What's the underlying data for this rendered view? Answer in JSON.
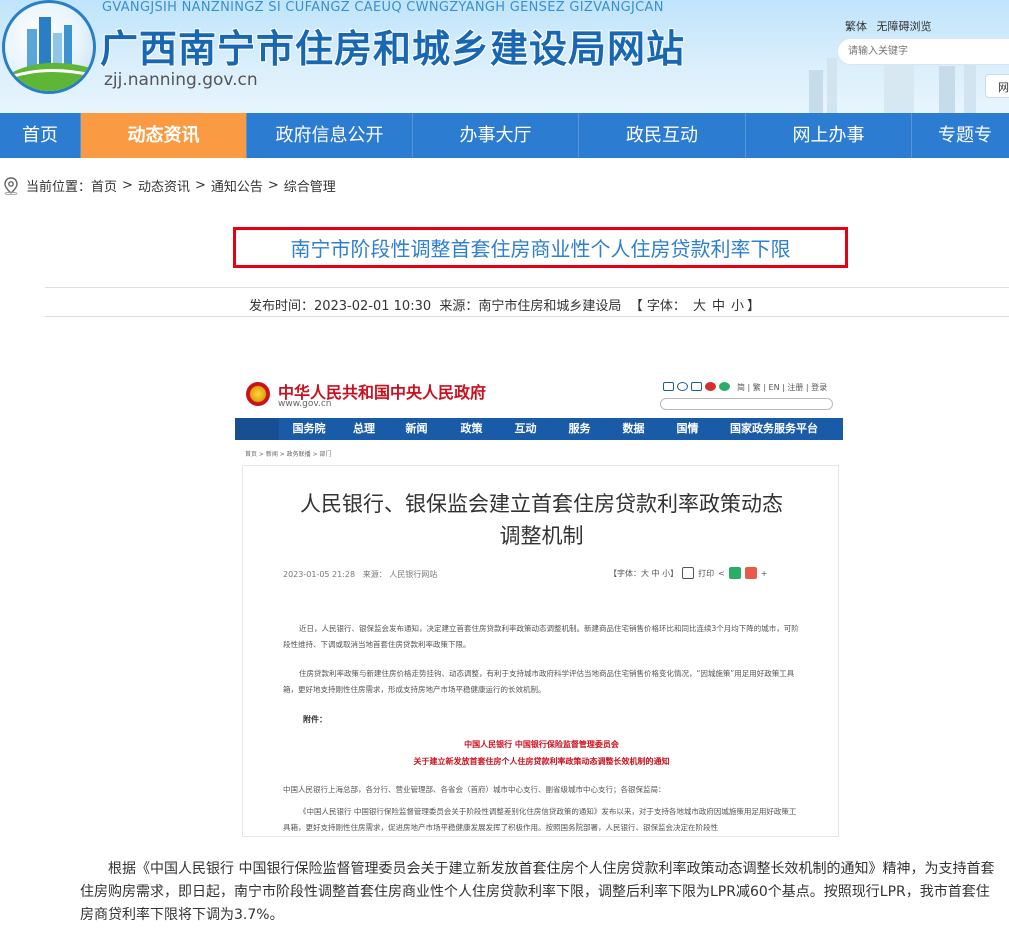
{
  "site": {
    "pinyin": "GVANGJSIH NANZNINGZ SI CUFANGZ CAEUQ CWNGZYANGH GENSEZ GIZVANGJCAN",
    "title": "广西南宁市住房和城乡建设局网站",
    "domain": "zjj.nanning.gov.cn",
    "top_links": [
      "繁体",
      "无障碍浏览"
    ],
    "search_placeholder": "请输入关键字",
    "side_button": "网"
  },
  "nav": {
    "items": [
      {
        "label": "首页",
        "active": false
      },
      {
        "label": "动态资讯",
        "active": true
      },
      {
        "label": "政府信息公开",
        "active": false
      },
      {
        "label": "办事大厅",
        "active": false
      },
      {
        "label": "政民互动",
        "active": false
      },
      {
        "label": "网上办事",
        "active": false
      },
      {
        "label": "专题专",
        "active": false
      }
    ]
  },
  "breadcrumb": {
    "prefix": "当前位置：",
    "items": [
      "首页",
      "动态资讯",
      "通知公告",
      "综合管理"
    ],
    "separator": ">"
  },
  "article": {
    "title": "南宁市阶段性调整首套住房商业性个人住房贷款利率下限",
    "publish_label": "发布时间：",
    "publish_time": "2023-02-01 10:30",
    "source_label": "来源：",
    "source": "南宁市住房和城乡建设局",
    "font_label": "【 字体：",
    "font_sizes": [
      "大",
      "中",
      "小"
    ],
    "font_close": "】",
    "body": "根据《中国人民银行 中国银行保险监督管理委员会关于建立新发放首套住房个人住房贷款利率政策动态调整长效机制的通知》精神，为支持首套住房购房需求，即日起，南宁市阶段性调整首套住房商业性个人住房贷款利率下限，调整后利率下限为LPR减60个基点。按照现行LPR，我市首套住房商贷利率下限将下调为3.7%。"
  },
  "screenshot": {
    "gov_name": "中华人民共和国中央人民政府",
    "gov_url": "www.gov.cn",
    "gov_links": "简 | 繁 | EN | 注册 | 登录",
    "nav": [
      "国务院",
      "总理",
      "新闻",
      "政策",
      "互动",
      "服务",
      "数据",
      "国情",
      "国家政务服务平台"
    ],
    "crumb": "首页  >  新闻  >  政务联播  >  部门",
    "doc_title_1": "人民银行、银保监会建立首套住房贷款利率政策动态",
    "doc_title_2": "调整机制",
    "doc_time": "2023-01-05 21:28",
    "doc_source": "来源：  人民银行网站",
    "doc_font": "【字体：大  中  小】",
    "doc_print": "打印",
    "p1": "近日，人民银行、银保监会发布通知，决定建立首套住房贷款利率政策动态调整机制。新建商品住宅销售价格环比和同比连续3个月均下降的城市，可阶段性维持、下调或取消当地首套住房贷款利率政策下限。",
    "p2": "住房贷款利率政策与新建住房价格走势挂钩、动态调整，有利于支持城市政府科学评估当地商品住宅销售价格变化情况，“因城施策”用足用好政策工具箱，更好地支持刚性住房需求，形成支持房地产市场平稳健康运行的长效机制。",
    "annex": "附件：",
    "org_line": "中国人民银行  中国银行保险监督管理委员会",
    "notice_title": "关于建立新发放首套住房个人住房贷款利率政策动态调整长效机制的通知",
    "to_line": "中国人民银行上海总部，各分行、营业管理部、各省会（首府）城市中心支行、副省级城市中心支行；各银保监局：",
    "p3": "《中国人民银行 中国银行保险监督管理委员会关于阶段性调整差别化住房信贷政策的通知》发布以来，对于支持各地城市政府因城施策用足用好政策工具箱，更好支持刚性住房需求，促进房地产市场平稳健康发展发挥了积极作用。按照国务院部署，人民银行、银保监会决定在阶段性"
  }
}
